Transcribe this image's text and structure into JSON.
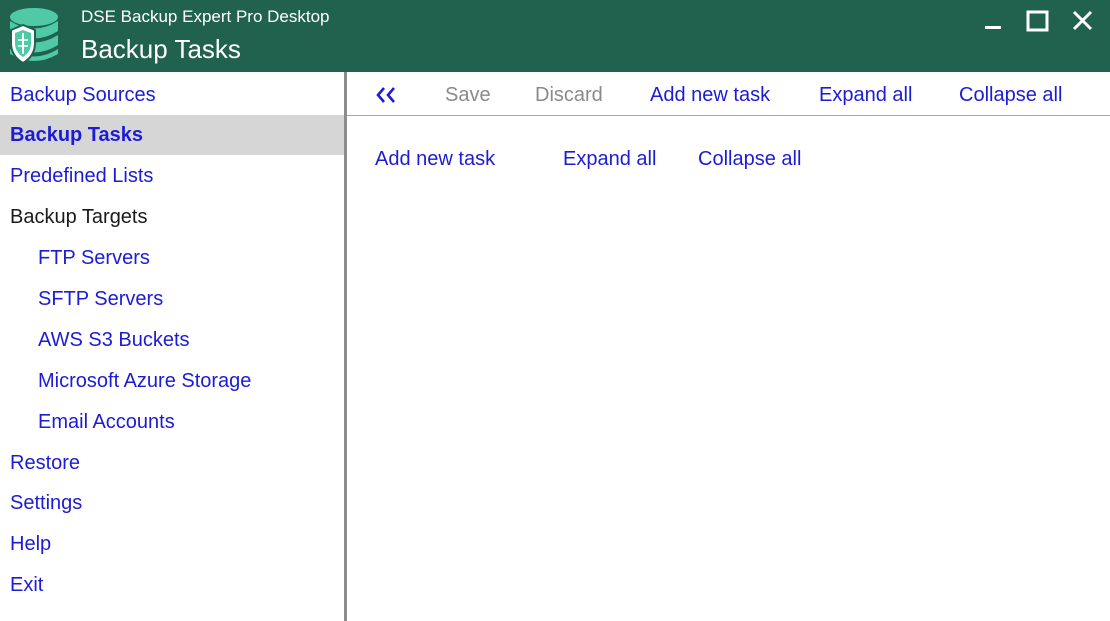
{
  "window": {
    "app_name": "DSE Backup Expert Pro Desktop",
    "page_heading": "Backup Tasks",
    "logo_icon": "database-shield-icon",
    "controls": [
      "minimize-icon",
      "maximize-icon",
      "close-icon"
    ]
  },
  "colors": {
    "titlebar": "#21624f",
    "logo": "#4fc9a6",
    "link": "#1c1cd6",
    "disabled": "#8a8a8a",
    "active_nav_bg": "#d6d6d6"
  },
  "sidebar": {
    "items": [
      {
        "label": "Backup Sources"
      },
      {
        "label": "Backup Tasks",
        "active": true
      },
      {
        "label": "Predefined Lists"
      },
      {
        "label": "Backup Targets",
        "group": true
      },
      {
        "label": "FTP Servers",
        "sub": true
      },
      {
        "label": "SFTP Servers",
        "sub": true
      },
      {
        "label": "AWS S3 Buckets",
        "sub": true
      },
      {
        "label": "Microsoft Azure Storage",
        "sub": true
      },
      {
        "label": "Email Accounts",
        "sub": true
      },
      {
        "label": "Restore"
      },
      {
        "label": "Settings"
      },
      {
        "label": "Help"
      },
      {
        "label": "Exit"
      }
    ]
  },
  "toolbar": {
    "back_icon": "double-chevron-left-icon",
    "save": "Save",
    "discard": "Discard",
    "add_new_task": "Add new task",
    "expand_all": "Expand all",
    "collapse_all": "Collapse all"
  },
  "content": {
    "add_new_task": "Add new task",
    "expand_all": "Expand all",
    "collapse_all": "Collapse all"
  }
}
